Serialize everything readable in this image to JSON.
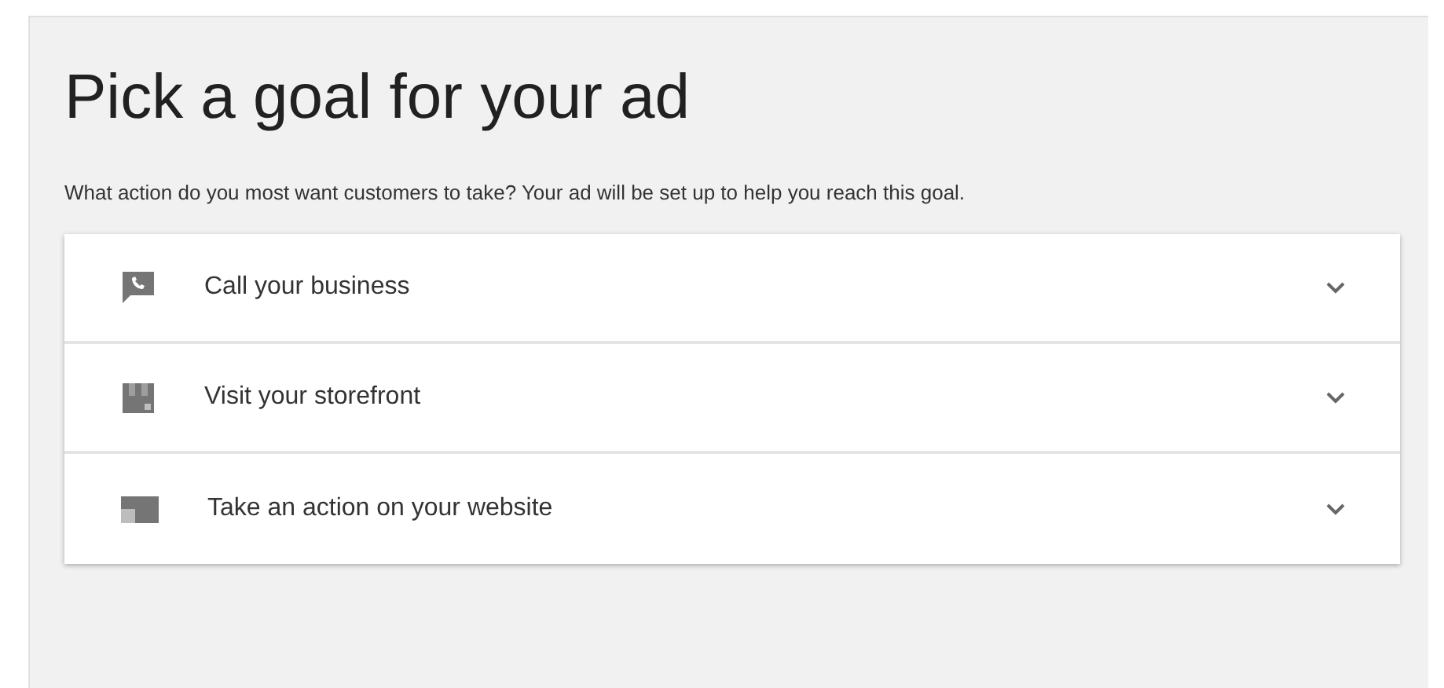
{
  "title": "Pick a goal for your ad",
  "description": "What action do you most want customers to take? Your ad will be set up to help you reach this goal.",
  "goals": [
    {
      "kind": "call",
      "label": "Call your business",
      "expanded": false
    },
    {
      "kind": "store",
      "label": "Visit your storefront",
      "expanded": false
    },
    {
      "kind": "web",
      "label": "Take an action on your website",
      "expanded": false
    }
  ]
}
